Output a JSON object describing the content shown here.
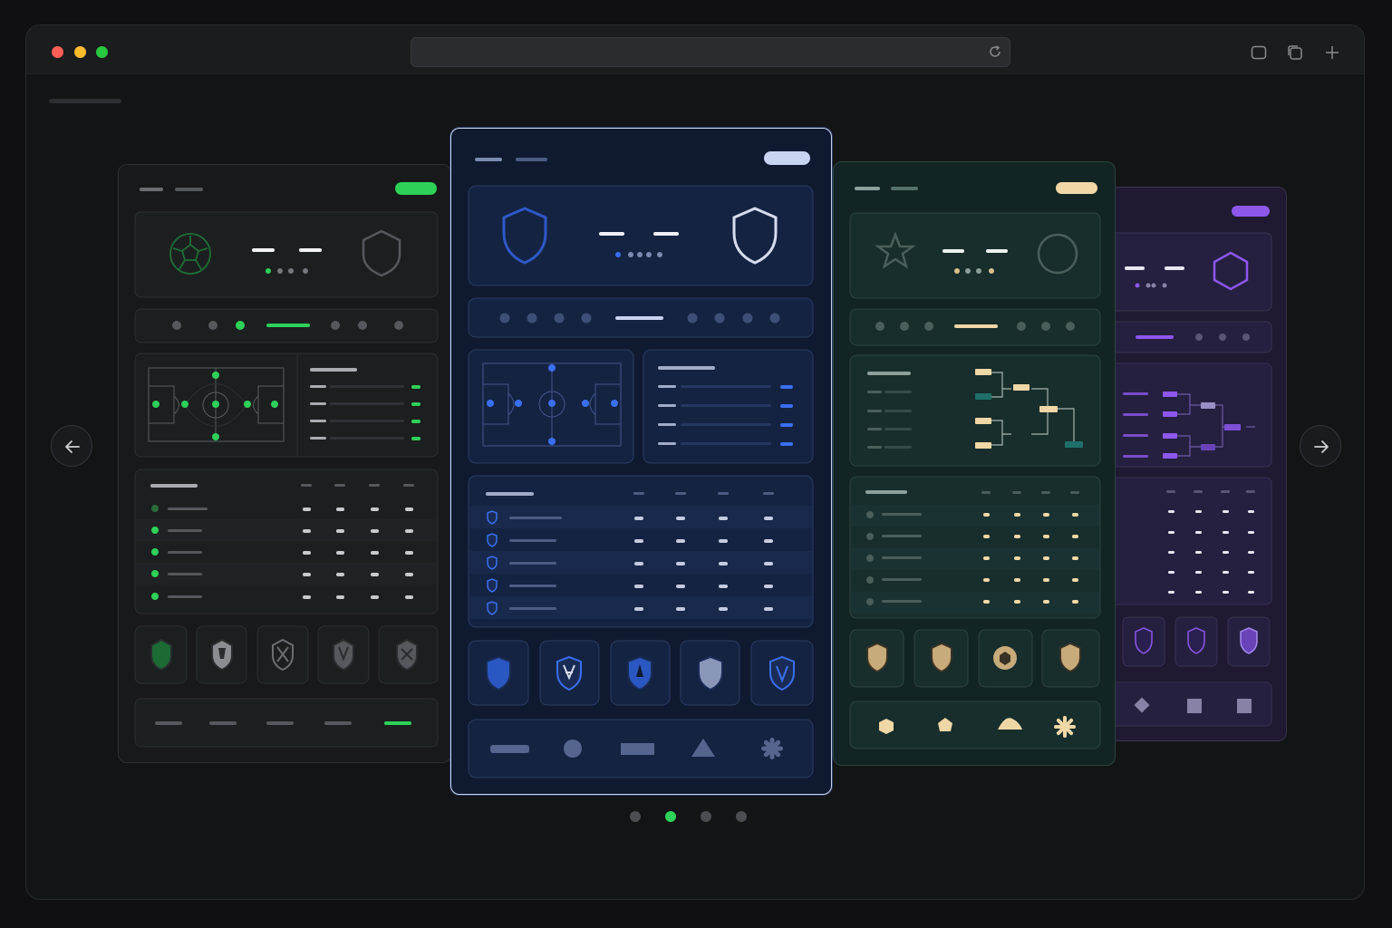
{
  "browser": {
    "lights": [
      "#ff5f57",
      "#febc2e",
      "#28c840"
    ],
    "icons": [
      "reload-icon",
      "sidebar-icon",
      "tabs-icon",
      "new-tab-icon"
    ]
  },
  "carousel": {
    "active_index": 1,
    "count": 4,
    "themes": [
      {
        "name": "green",
        "accent": "#2ed158",
        "bg": "#17191a"
      },
      {
        "name": "blue",
        "accent": "#3a6ff0",
        "bg": "#0f1a30"
      },
      {
        "name": "teal-gold",
        "accent": "#f0d7a6",
        "bg": "#122423"
      },
      {
        "name": "purple",
        "accent": "#8d57ec",
        "bg": "#211b35"
      }
    ],
    "icons": [
      "arrow-left-icon",
      "arrow-right-icon"
    ]
  }
}
